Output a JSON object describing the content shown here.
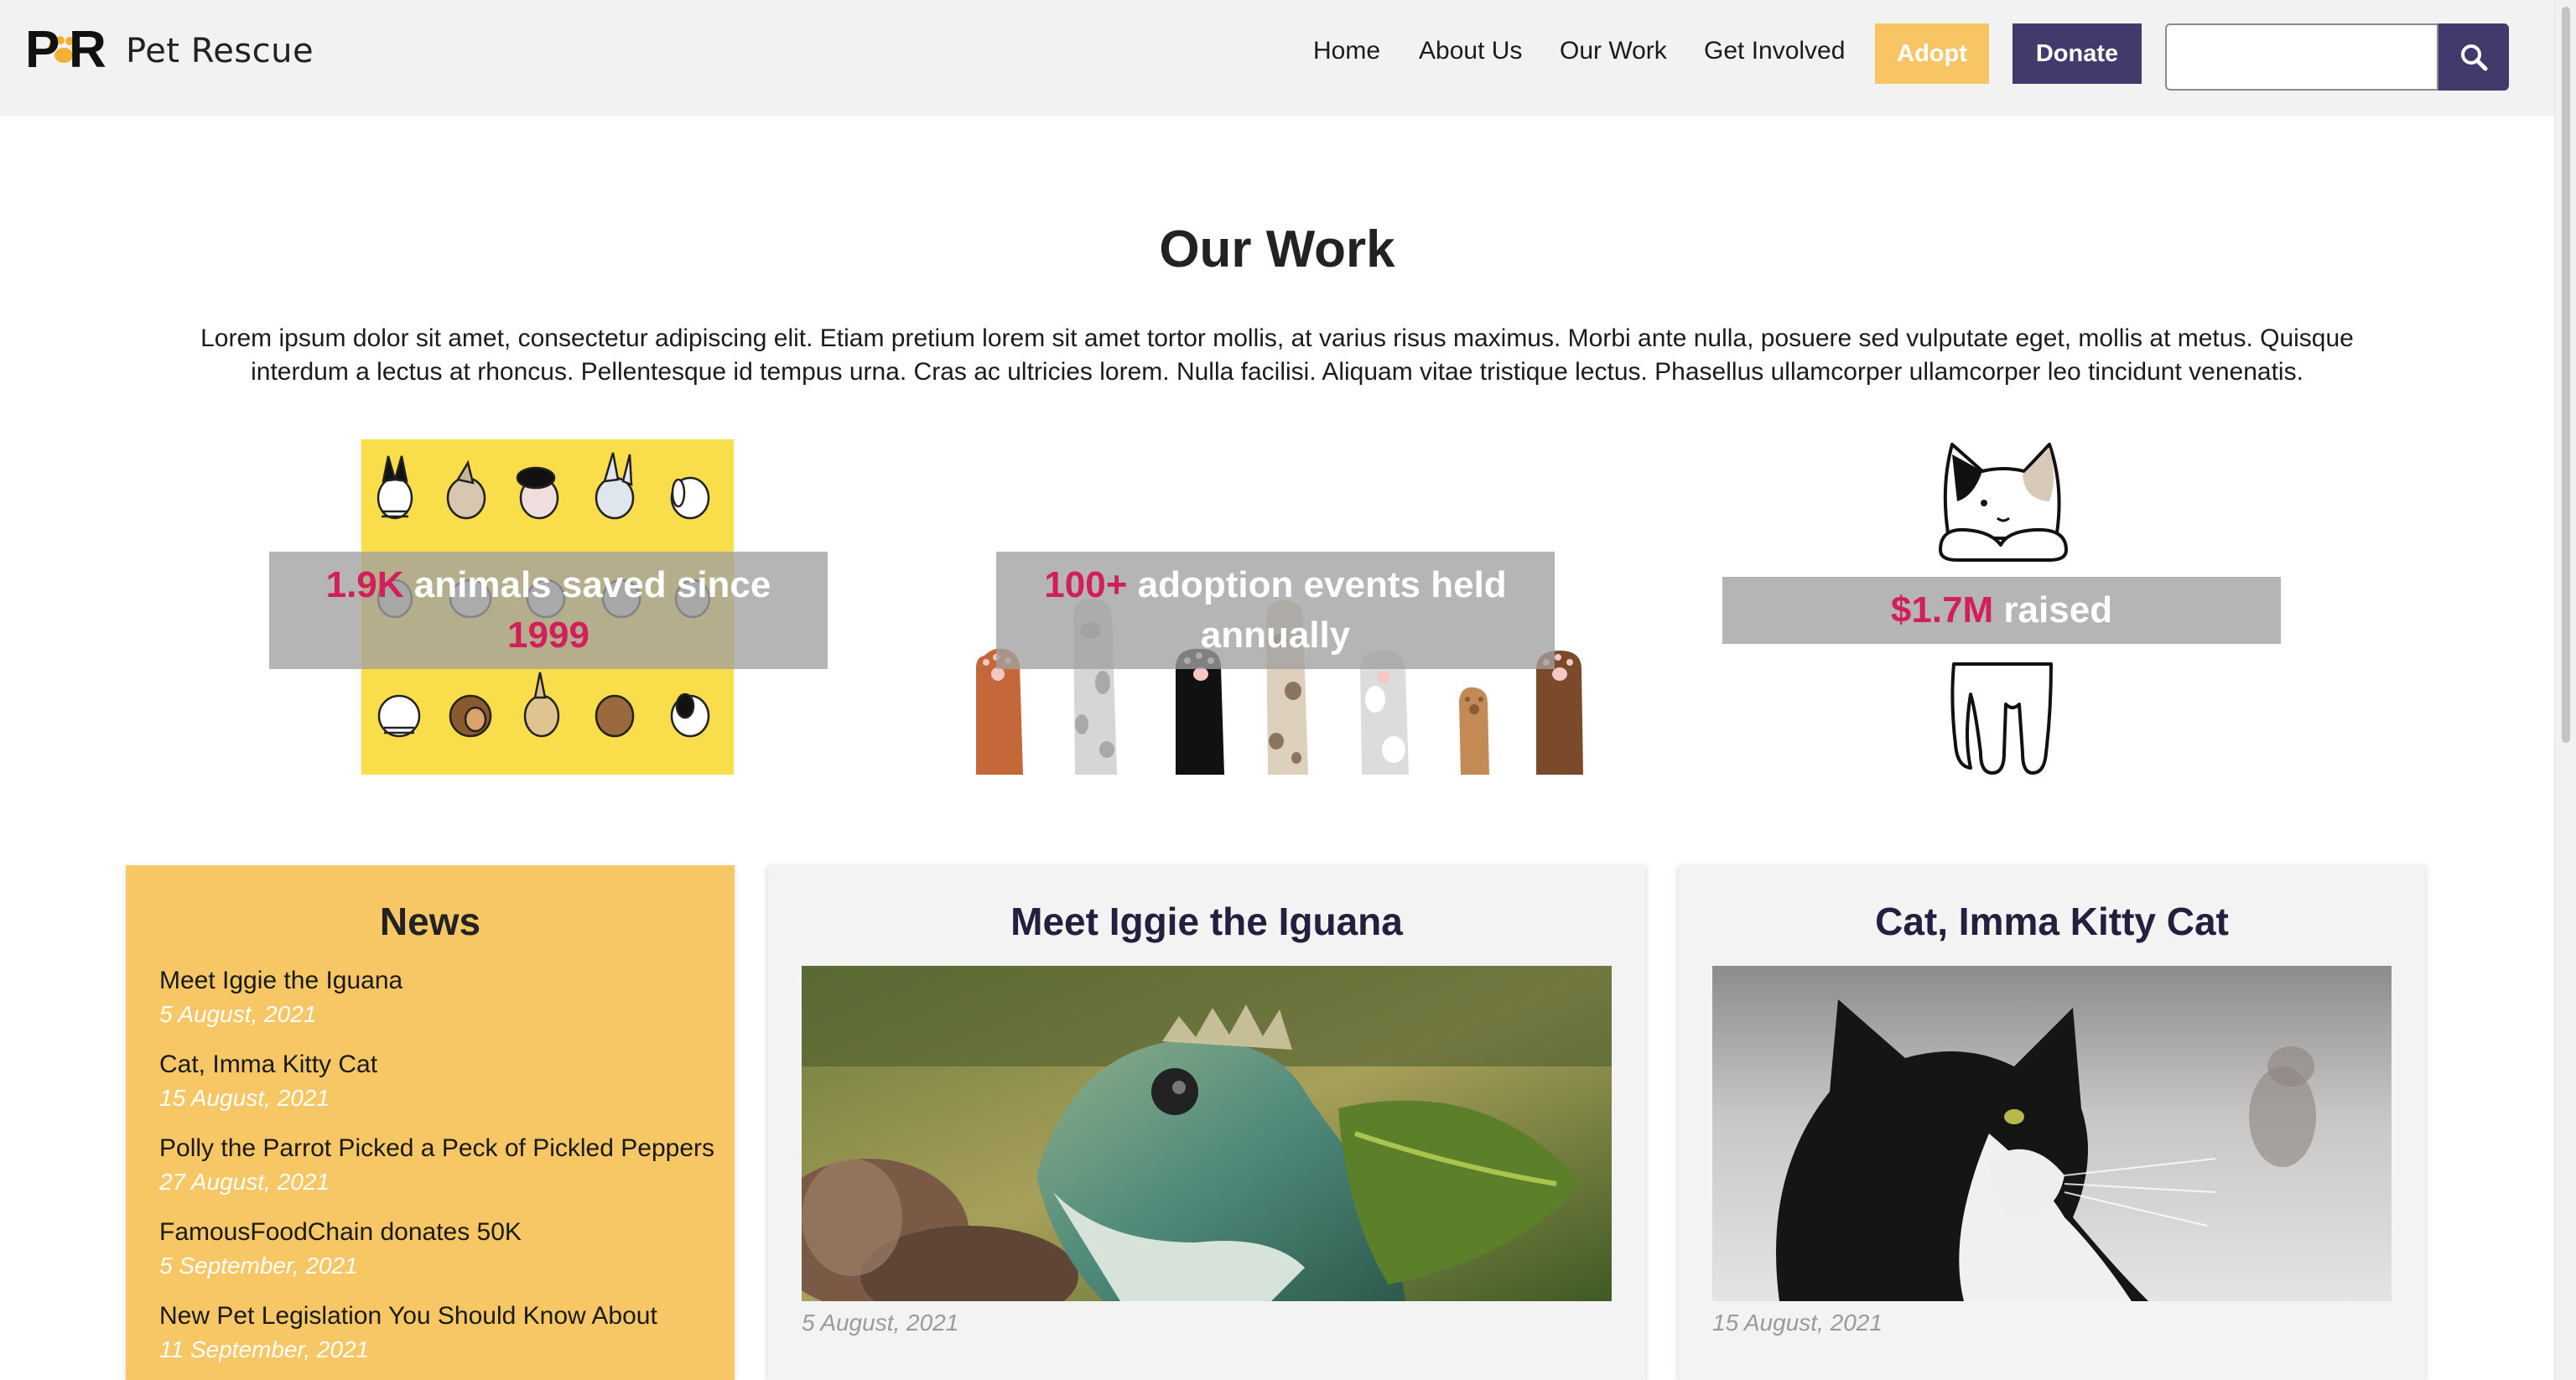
{
  "header": {
    "brand": "Pet Rescue",
    "nav": [
      "Home",
      "About Us",
      "Our Work",
      "Get Involved"
    ],
    "adopt_label": "Adopt",
    "donate_label": "Donate",
    "search_placeholder": "",
    "search_icon": "search-icon"
  },
  "page": {
    "title": "Our Work",
    "intro": "Lorem ipsum dolor sit amet, consectetur adipiscing elit. Etiam pretium lorem sit amet tortor mollis, at varius risus maximus. Morbi ante nulla, posuere sed vulputate eget, mollis at metus. Quisque interdum a lectus at rhoncus. Pellentesque id tempus urna. Cras ac ultricies lorem. Nulla facilisi. Aliquam vitae tristique lectus. Phasellus ullamcorper ullamcorper leo tincidunt venenatis."
  },
  "stats": [
    {
      "number": "1.9K",
      "pre": "",
      "text": " animals saved since ",
      "number2": "1999"
    },
    {
      "number": "100+",
      "text": " adoption events held annually"
    },
    {
      "number": "$1.7M",
      "text": " raised"
    }
  ],
  "news": {
    "heading": "News",
    "items": [
      {
        "title": "Meet Iggie the Iguana",
        "date": "5 August, 2021"
      },
      {
        "title": "Cat, Imma Kitty Cat",
        "date": "15 August, 2021"
      },
      {
        "title": "Polly the Parrot Picked a Peck of Pickled Peppers",
        "date": "27 August, 2021"
      },
      {
        "title": "FamousFoodChain donates 50K",
        "date": "5 September, 2021"
      },
      {
        "title": "New Pet Legislation You Should Know About",
        "date": "11 September, 2021"
      }
    ]
  },
  "cards": [
    {
      "title": "Meet Iggie the Iguana",
      "date": "5 August, 2021"
    },
    {
      "title": "Cat, Imma Kitty Cat",
      "date": "15 August, 2021"
    }
  ],
  "colors": {
    "header_bg": "#f2f2f2",
    "adopt": "#f7c563",
    "donate": "#413a6b",
    "accent_number": "#d21f5a",
    "news_bg": "#f7c765",
    "card_title": "#23203f"
  }
}
